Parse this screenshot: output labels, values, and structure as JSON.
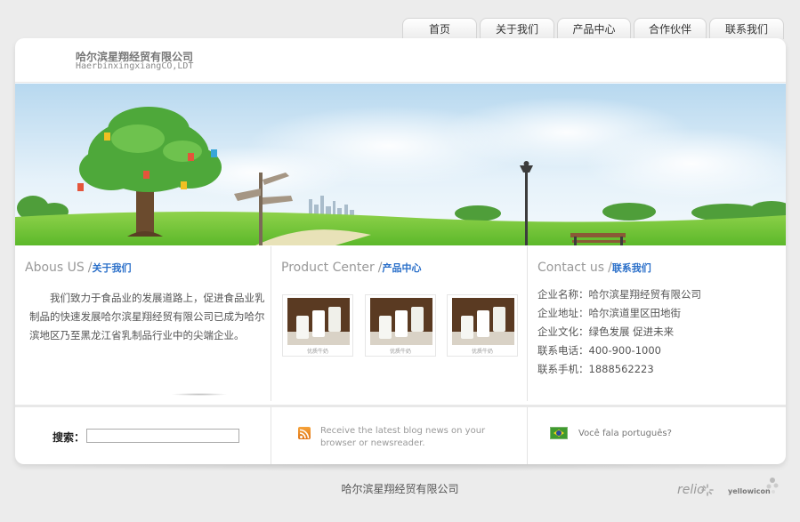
{
  "nav": {
    "items": [
      "首页",
      "关于我们",
      "产品中心",
      "合作伙伴",
      "联系我们"
    ]
  },
  "header": {
    "company_name": "哈尔滨星翔经贸有限公司",
    "company_en": "HaerbinxingxiangCO,LDT"
  },
  "about": {
    "title_en": "Abous US",
    "title_cn": "关于我们",
    "text": "我们致力于食品业的发展道路上，促进食品业乳制品的快速发展哈尔滨星翔经贸有限公司已成为哈尔滨地区乃至黑龙江省乳制品行业中的尖端企业。"
  },
  "products": {
    "title_en": "Product Center",
    "title_cn": "产品中心",
    "items": [
      {
        "caption": "优质牛奶"
      },
      {
        "caption": "优质牛奶"
      },
      {
        "caption": "优质牛奶"
      }
    ]
  },
  "contact": {
    "title_en": "Contact us",
    "title_cn": "联系我们",
    "lines": [
      "企业名称：哈尔滨星翔经贸有限公司",
      "企业地址：哈尔滨道里区田地街",
      "企业文化：绿色发展 促进未来",
      "联系电话：400-900-1000",
      "联系手机：1888562223"
    ]
  },
  "bottom": {
    "search_label": "搜索：",
    "search_value": "",
    "rss_text": "Receive the latest blog news on your browser or newsreader.",
    "lang_text": "Você fala português?"
  },
  "footer": {
    "copyright": "哈尔滨星翔经贸有限公司",
    "logo1": "relio",
    "logo2": "yellowicon"
  },
  "colors": {
    "accent": "#2a6fc9",
    "background": "#ececec",
    "grass": "#6cc33a"
  }
}
